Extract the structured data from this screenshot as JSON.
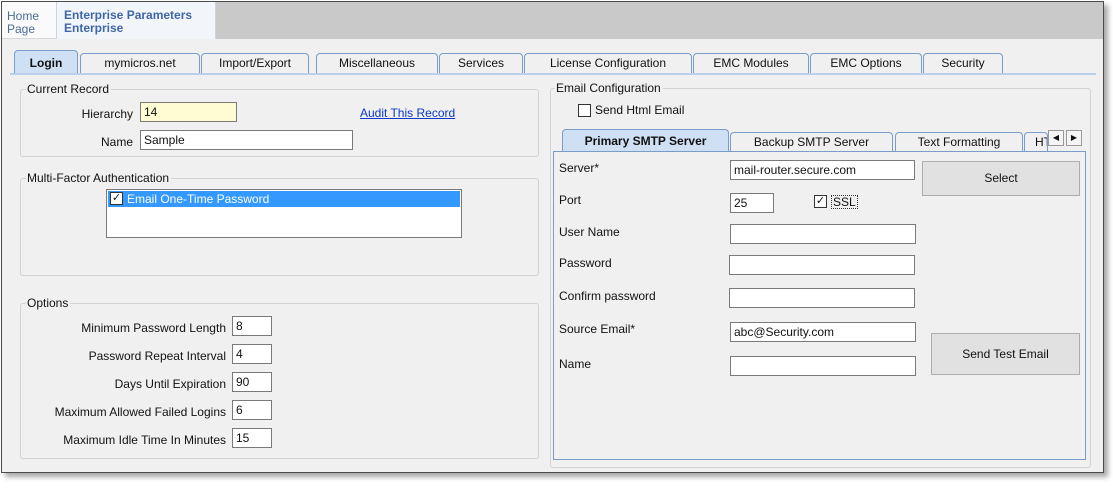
{
  "header": {
    "home_line1": "Home",
    "home_line2": "Page",
    "title_line1": "Enterprise Parameters",
    "title_line2": "Enterprise"
  },
  "tabs": [
    "Login",
    "mymicros.net",
    "Import/Export",
    "Miscellaneous",
    "Services",
    "License Configuration",
    "EMC Modules",
    "EMC Options",
    "Security"
  ],
  "current_record": {
    "legend": "Current Record",
    "hierarchy_label": "Hierarchy",
    "hierarchy_value": "14",
    "name_label": "Name",
    "name_value": "Sample",
    "audit_link": "Audit This Record"
  },
  "mfa": {
    "legend": "Multi-Factor Authentication",
    "items": [
      {
        "label": "Email One-Time Password",
        "checked": "✓"
      }
    ]
  },
  "options": {
    "legend": "Options",
    "fields": [
      {
        "label": "Minimum Password Length",
        "value": "8"
      },
      {
        "label": "Password Repeat Interval",
        "value": "4"
      },
      {
        "label": "Days Until Expiration",
        "value": "90"
      },
      {
        "label": "Maximum Allowed Failed Logins",
        "value": "6"
      },
      {
        "label": "Maximum Idle Time In Minutes",
        "value": "15"
      }
    ]
  },
  "email": {
    "legend": "Email Configuration",
    "send_html_label": "Send Html Email",
    "send_html_checked": "",
    "tabs": [
      "Primary SMTP Server",
      "Backup SMTP Server",
      "Text Formatting",
      "HT"
    ],
    "arrows": [
      "◀",
      "▶"
    ],
    "server_label": "Server*",
    "server_value": "mail-router.secure.com",
    "port_label": "Port",
    "port_value": "25",
    "ssl_label": "SSL",
    "ssl_checked": "✓",
    "username_label": "User Name",
    "username_value": "",
    "password_label": "Password",
    "password_value": "",
    "confirm_label": "Confirm password",
    "confirm_value": "",
    "source_label": "Source Email*",
    "source_value": "abc@Security.com",
    "name_label": "Name",
    "name_value": "",
    "select_button": "Select",
    "test_button": "Send Test Email"
  }
}
